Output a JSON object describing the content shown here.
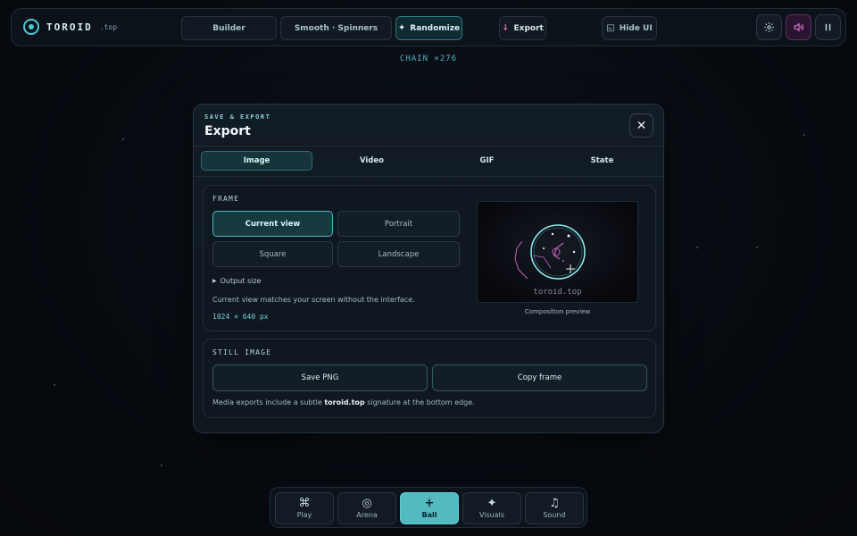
{
  "topbar": {
    "logo_name": "TOROID",
    "logo_tld": ".top",
    "builder_label": "Builder",
    "smooth_label": "Smooth · Spinners",
    "randomize_label": "Randomize",
    "export_label": "Export",
    "hide_ui_label": "Hide UI"
  },
  "chain_label": "CHAIN ×276",
  "modal": {
    "eyebrow": "SAVE & EXPORT",
    "title": "Export",
    "tabs": [
      {
        "label": "Image",
        "active": true
      },
      {
        "label": "Video",
        "active": false
      },
      {
        "label": "GIF",
        "active": false
      },
      {
        "label": "State",
        "active": false
      }
    ],
    "frame": {
      "title": "FRAME",
      "options": [
        {
          "label": "Current view",
          "active": true
        },
        {
          "label": "Portrait",
          "active": false
        },
        {
          "label": "Square",
          "active": false
        },
        {
          "label": "Landscape",
          "active": false
        }
      ],
      "output_size_label": "Output size",
      "description": "Current view matches your screen without the interface.",
      "dimensions": "1024 × 640 px",
      "preview_signature": "toroid.top",
      "preview_caption": "Composition preview"
    },
    "still": {
      "title": "STILL IMAGE",
      "save_png_label": "Save PNG",
      "copy_frame_label": "Copy frame",
      "note_before": "Media exports include a subtle ",
      "note_brand": "toroid.top",
      "note_after": " signature at the bottom edge."
    }
  },
  "dock": {
    "items": [
      {
        "label": "Play",
        "icon": "command-icon",
        "active": false
      },
      {
        "label": "Arena",
        "icon": "target-icon",
        "active": false
      },
      {
        "label": "Ball",
        "icon": "plus-icon",
        "active": true
      },
      {
        "label": "Visuals",
        "icon": "sparkle-icon",
        "active": false
      },
      {
        "label": "Sound",
        "icon": "music-note-icon",
        "active": false
      }
    ]
  },
  "colors": {
    "accent": "#4fc6d4",
    "accent_active": "#55b9c2",
    "sound_accent": "#e07bd7",
    "preview_ring": "#8ff0f3",
    "preview_trail": "#c85fb8"
  }
}
